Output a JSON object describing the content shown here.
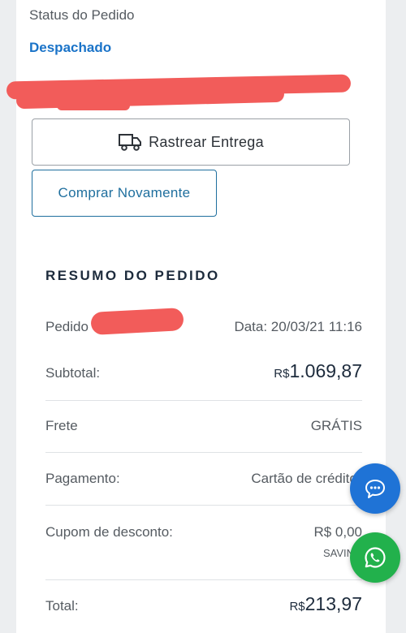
{
  "order_status": {
    "label": "Status do Pedido",
    "value": "Despachado"
  },
  "buttons": {
    "track": "Rastrear Entrega",
    "buy_again": "Comprar Novamente"
  },
  "summary": {
    "title": "RESUMO DO PEDIDO",
    "order_label": "Pedido",
    "date_label": "Data: 20/03/21 11:16",
    "subtotal_label": "Subtotal:",
    "subtotal_currency": "R$",
    "subtotal_value": "1.069,87",
    "shipping_label": "Frete",
    "shipping_value": "GRÁTIS",
    "payment_label": "Pagamento:",
    "payment_value": "Cartão de crédito 2",
    "coupon_label": "Cupom de desconto:",
    "coupon_value": "R$ 0,00",
    "coupon_code": "SAVIN",
    "total_label": "Total:",
    "total_currency": "R$",
    "total_value": "213,97"
  },
  "icons": {
    "truck": "truck-icon",
    "chat": "chat-icon",
    "whatsapp": "whatsapp-icon"
  },
  "colors": {
    "accent": "#1a73c8",
    "redaction": "#f25c5a",
    "chat_fab": "#1f73d6",
    "whatsapp_fab": "#22b14c"
  }
}
